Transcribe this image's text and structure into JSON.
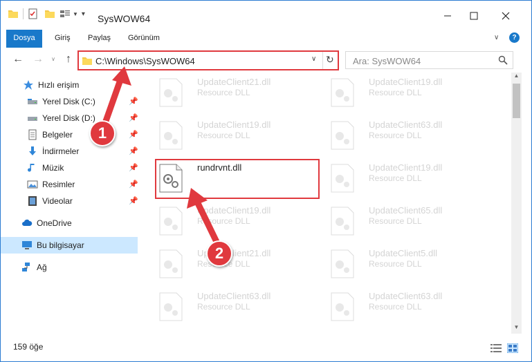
{
  "window": {
    "title": "SysWOW64"
  },
  "ribbon": {
    "tabs": [
      {
        "label": "Dosya"
      },
      {
        "label": "Giriş"
      },
      {
        "label": "Paylaş"
      },
      {
        "label": "Görünüm"
      }
    ]
  },
  "address": {
    "path": "C:\\Windows\\SysWOW64"
  },
  "search": {
    "placeholder": "Ara: SysWOW64"
  },
  "nav": {
    "items": [
      {
        "label": "Hızlı erişim",
        "icon": "star-icon"
      },
      {
        "label": "Yerel Disk (C:)",
        "icon": "drive-icon"
      },
      {
        "label": "Yerel Disk (D:)",
        "icon": "drive-icon"
      },
      {
        "label": "Belgeler",
        "icon": "documents-icon"
      },
      {
        "label": "İndirmeler",
        "icon": "download-icon"
      },
      {
        "label": "Müzik",
        "icon": "music-icon"
      },
      {
        "label": "Resimler",
        "icon": "pictures-icon"
      },
      {
        "label": "Videolar",
        "icon": "video-icon"
      },
      {
        "label": "OneDrive",
        "icon": "cloud-icon"
      },
      {
        "label": "Bu bilgisayar",
        "icon": "computer-icon"
      },
      {
        "label": "Ağ",
        "icon": "network-icon"
      }
    ]
  },
  "files": [
    {
      "name": "UpdateClient21.dll",
      "type": "Resource DLL"
    },
    {
      "name": "UpdateClient19.dll",
      "type": "Resource DLL"
    },
    {
      "name": "UpdateClient19.dll",
      "type": "Resource DLL"
    },
    {
      "name": "UpdateClient63.dll",
      "type": "Resource DLL"
    },
    {
      "name": "rundrvnt.dll",
      "type": ""
    },
    {
      "name": "UpdateClient19.dll",
      "type": "Resource DLL"
    },
    {
      "name": "UpdateClient19.dll",
      "type": "Resource DLL"
    },
    {
      "name": "UpdateClient65.dll",
      "type": "Resource DLL"
    },
    {
      "name": "UpdateClient21.dll",
      "type": "Resource DLL"
    },
    {
      "name": "UpdateClient5.dll",
      "type": "Resource DLL"
    },
    {
      "name": "UpdateClient63.dll",
      "type": "Resource DLL"
    },
    {
      "name": "UpdateClient63.dll",
      "type": "Resource DLL"
    }
  ],
  "status": {
    "count": "159 öğe"
  },
  "annotations": {
    "step1": "1",
    "step2": "2"
  },
  "colors": {
    "accent": "#1979ca",
    "highlight": "#e0393e",
    "selection": "#cce8ff"
  }
}
